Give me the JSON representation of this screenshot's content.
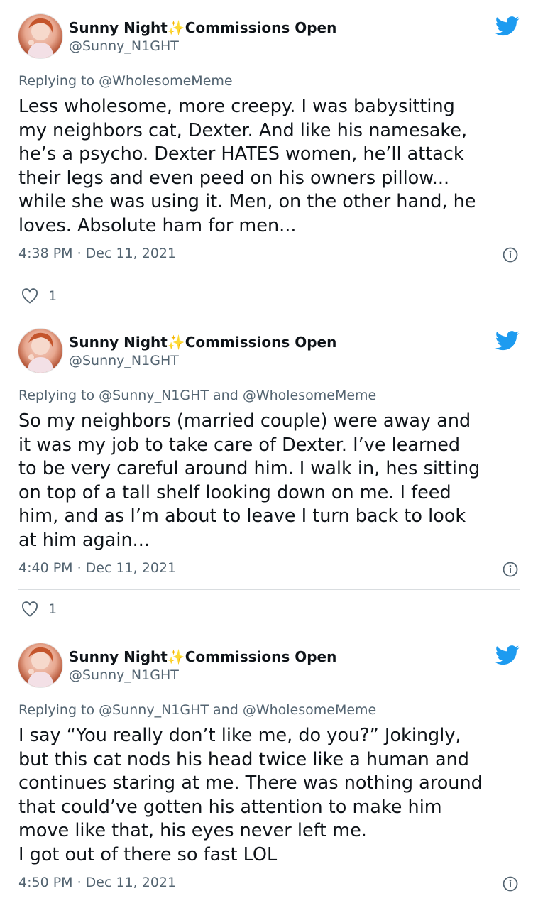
{
  "tweets": [
    {
      "name": "Sunny Night",
      "name_suffix": "Commissions Open",
      "sparkle": "✨",
      "handle": "@Sunny_N1GHT",
      "replying_to": "Replying to @WholesomeMeme",
      "text": "Less wholesome, more creepy. I was babysitting\nmy neighbors cat, Dexter. And like his namesake,\nhe’s a psycho. Dexter HATES women, he’ll attack\ntheir legs and even peed on his owners pillow...\nwhile she was using it. Men, on the other hand, he\nloves. Absolute ham for men...",
      "timestamp": "4:38 PM · Dec 11, 2021",
      "likes": "1"
    },
    {
      "name": "Sunny Night",
      "name_suffix": "Commissions Open",
      "sparkle": "✨",
      "handle": "@Sunny_N1GHT",
      "replying_to": "Replying to @Sunny_N1GHT and @WholesomeMeme",
      "text": "So my neighbors (married couple) were away and\nit was my job to take care of Dexter. I’ve learned\nto be very careful around him. I walk in, hes sitting\non top of a tall shelf looking down on me. I feed\nhim, and as I’m about to leave I turn back to look\nat him again...",
      "timestamp": "4:40 PM · Dec 11, 2021",
      "likes": "1"
    },
    {
      "name": "Sunny Night",
      "name_suffix": "Commissions Open",
      "sparkle": "✨",
      "handle": "@Sunny_N1GHT",
      "replying_to": "Replying to @Sunny_N1GHT and @WholesomeMeme",
      "text": "I say “You really don’t like me, do you?” Jokingly,\nbut this cat nods his head twice like a human and\ncontinues staring at me. There was nothing around\nthat could’ve gotten his attention to make him\nmove like that, his eyes never left me.\nI got out of there so fast LOL",
      "timestamp": "4:50 PM · Dec 11, 2021"
    }
  ],
  "icons": {
    "logo": "twitter-bird-icon",
    "info": "info-icon",
    "like": "heart-icon"
  },
  "colors": {
    "twitter_blue": "#1d9bf0",
    "secondary_text": "#536471",
    "sparkle": "#f5b51f"
  }
}
